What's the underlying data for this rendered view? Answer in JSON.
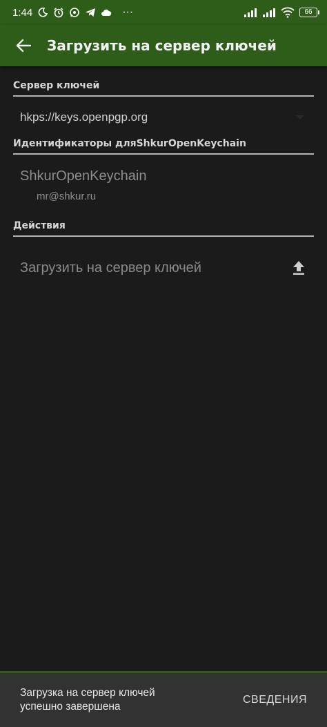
{
  "status_bar": {
    "time": "1:44",
    "battery": "66",
    "more": "···"
  },
  "app_bar": {
    "title": "Загрузить на сервер ключей"
  },
  "keyserver_section": {
    "header": "Сервер ключей",
    "selected_value": "hkps://keys.openpgp.org"
  },
  "identities_section": {
    "header": "Идентификаторы дляShkurOpenKeychain",
    "name": "ShkurOpenKeychain",
    "email": "mr@shkur.ru"
  },
  "actions_section": {
    "header": "Действия",
    "upload_label": "Загрузить на сервер ключей"
  },
  "snackbar": {
    "line1": "Загрузка на сервер ключей",
    "line2": "успешно завершена",
    "action": "СВЕДЕНИЯ"
  },
  "colors": {
    "primary": "#2e5d1a",
    "background": "#1b1b1b",
    "snackbar": "#323232"
  }
}
